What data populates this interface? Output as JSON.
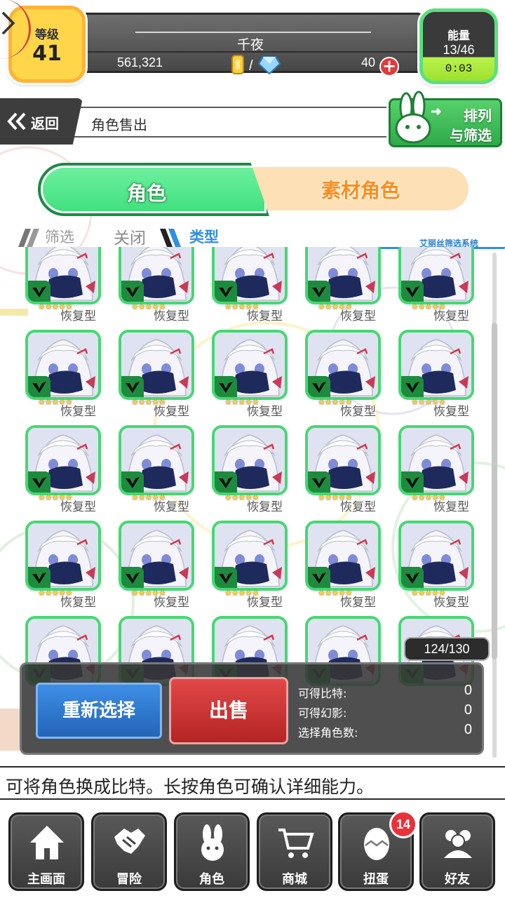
{
  "header": {
    "level_label": "等级",
    "level_value": "41",
    "player_name": "千夜",
    "bits": "561,321",
    "gems": "40",
    "add_symbol": "+",
    "energy_label": "能量",
    "energy_value": "13/46",
    "energy_timer": "0:03"
  },
  "nav": {
    "back_label": "返回",
    "page_title": "角色售出",
    "sort_line1": "排列",
    "sort_line2": "与筛选"
  },
  "tabs": {
    "role": "角色",
    "material": "素材角色"
  },
  "filter": {
    "label": "筛选",
    "close": "关闭",
    "type": "类型",
    "system": "艾丽丝筛选系统"
  },
  "grid": {
    "columns": 5,
    "cards": [
      {
        "type": "恢复型",
        "stars": "★★★★★"
      },
      {
        "type": "恢复型",
        "stars": "★★★★★"
      },
      {
        "type": "恢复型",
        "stars": "★★★★★"
      },
      {
        "type": "恢复型",
        "stars": "★★★★★"
      },
      {
        "type": "恢复型",
        "stars": "★★★★★"
      },
      {
        "type": "恢复型",
        "stars": "★★★★★"
      },
      {
        "type": "恢复型",
        "stars": "★★★★★"
      },
      {
        "type": "恢复型",
        "stars": "★★★★★"
      },
      {
        "type": "恢复型",
        "stars": "★★★★★"
      },
      {
        "type": "恢复型",
        "stars": "★★★★★"
      },
      {
        "type": "恢复型",
        "stars": "★★★★★"
      },
      {
        "type": "恢复型",
        "stars": "★★★★★"
      },
      {
        "type": "恢复型",
        "stars": "★★★★★"
      },
      {
        "type": "恢复型",
        "stars": "★★★★★"
      },
      {
        "type": "恢复型",
        "stars": "★★★★★"
      },
      {
        "type": "恢复型",
        "stars": "★★★★★"
      },
      {
        "type": "恢复型",
        "stars": "★★★★★"
      },
      {
        "type": "恢复型",
        "stars": "★★★★★"
      },
      {
        "type": "恢复型",
        "stars": "★★★★★"
      },
      {
        "type": "恢复型",
        "stars": "★★★★★"
      },
      {
        "type": "",
        "stars": ""
      },
      {
        "type": "",
        "stars": ""
      },
      {
        "type": "",
        "stars": ""
      },
      {
        "type": "",
        "stars": ""
      },
      {
        "type": "",
        "stars": ""
      }
    ]
  },
  "capacity": "124/130",
  "sell_panel": {
    "reselect_label": "重新选择",
    "sell_label": "出售",
    "bits_label": "可得比特:",
    "bits_value": "0",
    "phantom_label": "可得幻影:",
    "phantom_value": "0",
    "count_label": "选择角色数:",
    "count_value": "0"
  },
  "hint": "可将角色换成比特。长按角色可确认详细能力。",
  "bottom_nav": [
    {
      "label": "主画面",
      "icon": "home-icon"
    },
    {
      "label": "冒险",
      "icon": "handshake-icon"
    },
    {
      "label": "角色",
      "icon": "bunny-icon"
    },
    {
      "label": "商城",
      "icon": "cart-icon"
    },
    {
      "label": "扭蛋",
      "icon": "egg-icon",
      "badge": "14"
    },
    {
      "label": "好友",
      "icon": "friends-icon"
    }
  ],
  "colors": {
    "accent_green": "#46d873",
    "accent_orange": "#ff8c1a",
    "sell_red": "#c83030",
    "reselect_blue": "#2f7ad0",
    "level_yellow": "#ffd64a"
  }
}
